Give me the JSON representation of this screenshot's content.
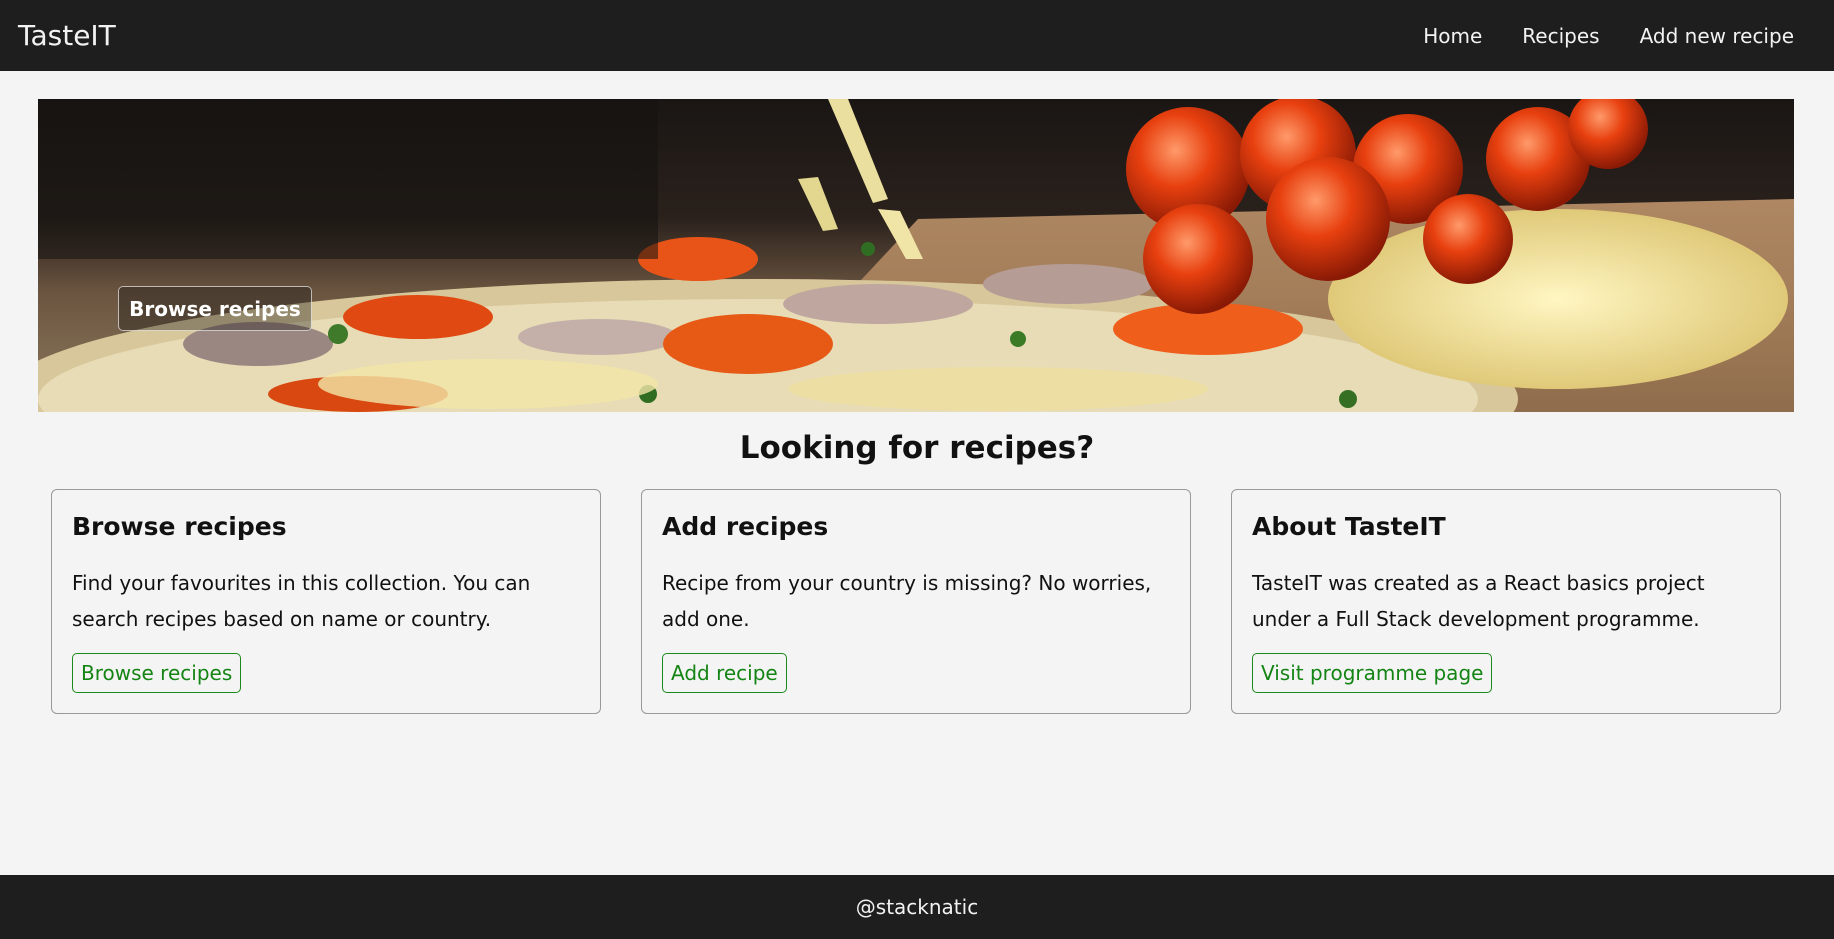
{
  "nav": {
    "brand": "TasteIT",
    "links": [
      "Home",
      "Recipes",
      "Add new recipe"
    ]
  },
  "hero": {
    "button_label": "Browse recipes"
  },
  "headline": "Looking for recipes?",
  "cards": [
    {
      "title": "Browse recipes",
      "text": "Find your favourites in this collection. You can search recipes based on name or country.",
      "button": "Browse recipes"
    },
    {
      "title": "Add recipes",
      "text": "Recipe from your country is missing? No worries, add one.",
      "button": "Add recipe"
    },
    {
      "title": "About TasteIT",
      "text": "TasteIT was created as a React basics project under a Full Stack development programme.",
      "button": "Visit programme page"
    }
  ],
  "footer": {
    "text": "@stacknatic"
  },
  "colors": {
    "nav_bg": "#1e1e1e",
    "page_bg": "#f4f4f4",
    "accent_green": "#148414"
  }
}
